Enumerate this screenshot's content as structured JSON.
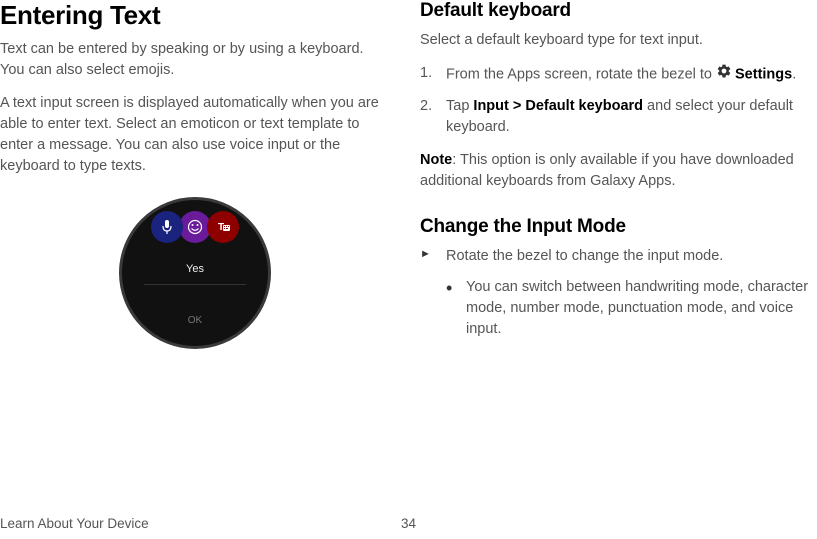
{
  "left": {
    "heading": "Entering Text",
    "p1": "Text can be entered by speaking or by using a keyboard. You can also select emojis.",
    "p2": "A text input screen is displayed automatically when you are able to enter text. Select an emoticon or text template to enter a message. You can also use voice input or the keyboard to type texts.",
    "watch": {
      "yes": "Yes",
      "ok": "OK"
    }
  },
  "right": {
    "heading1": "Default keyboard",
    "p1": "Select a default keyboard type for text input.",
    "step1_prefix": "From the Apps screen, rotate the bezel to ",
    "step1_bold": "Settings",
    "step1_suffix": ".",
    "step2_prefix": "Tap ",
    "step2_bold": "Input > Default keyboard",
    "step2_suffix": " and select your default keyboard.",
    "note_label": "Note",
    "note_text": ": This option is only available if you have downloaded additional keyboards from Galaxy Apps.",
    "heading2": "Change the Input Mode",
    "arrow_text": "Rotate the bezel to change the input mode.",
    "bullet_text": "You can switch between handwriting mode, character mode, number mode, punctuation mode, and voice input."
  },
  "footer": {
    "section": "Learn About Your Device",
    "page": "34"
  }
}
